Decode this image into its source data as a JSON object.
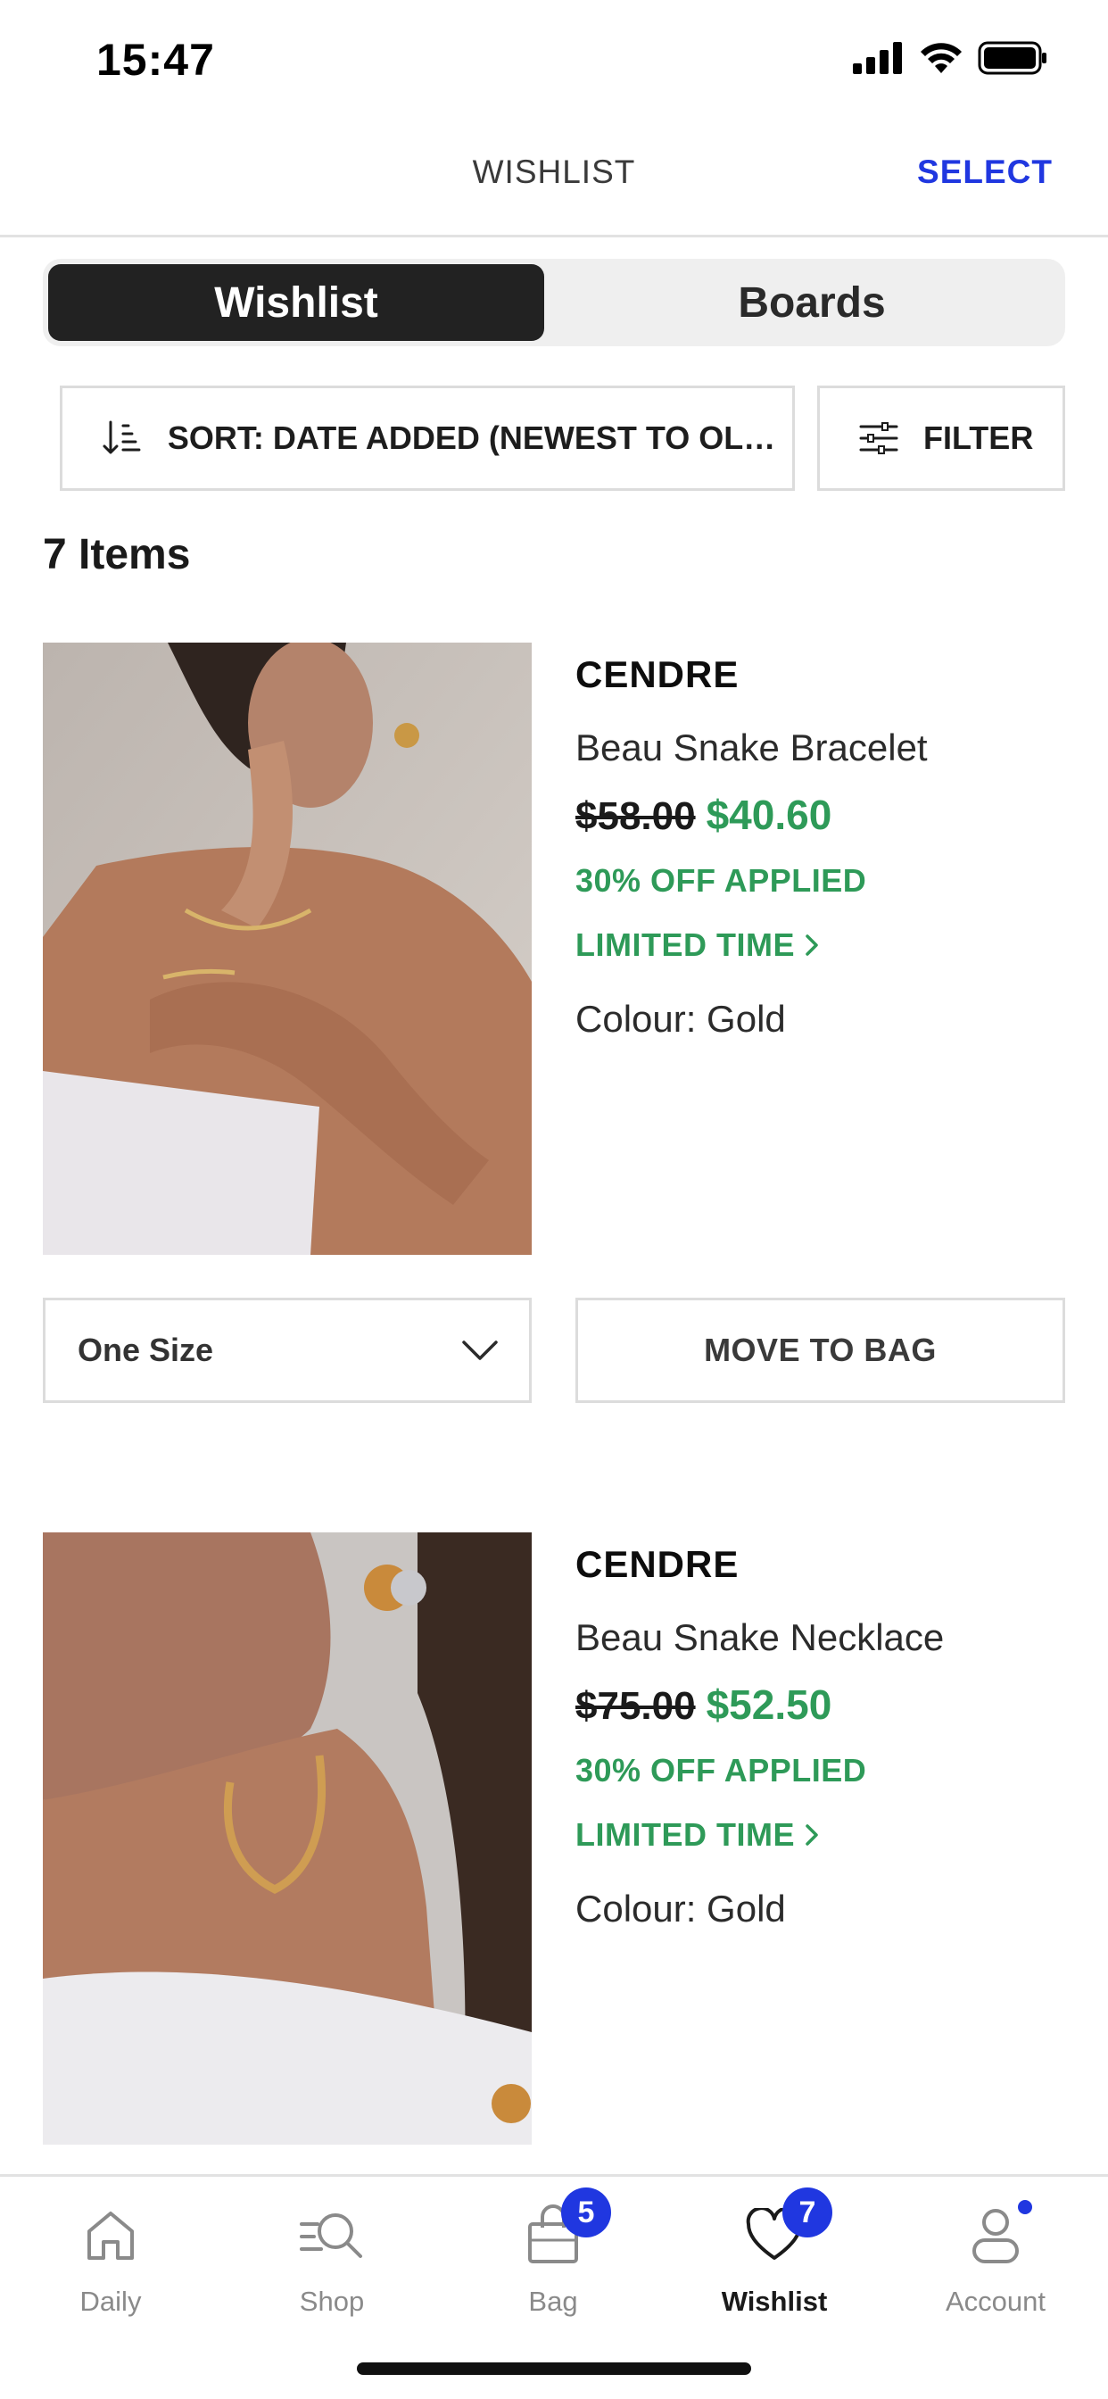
{
  "status": {
    "time": "15:47"
  },
  "header": {
    "title": "WISHLIST",
    "select_label": "SELECT"
  },
  "tabs": {
    "wishlist": "Wishlist",
    "boards": "Boards"
  },
  "toolbar": {
    "sort_label": "SORT: DATE ADDED (NEWEST TO OLD...",
    "filter_label": "FILTER"
  },
  "count_label": "7 Items",
  "products": [
    {
      "brand": "CENDRE",
      "name": "Beau Snake Bracelet",
      "old_price": "$58.00",
      "new_price": "$40.60",
      "discount": "30% OFF APPLIED",
      "limited": "LIMITED TIME",
      "colour": "Colour: Gold",
      "size": "One Size",
      "move_label": "MOVE TO BAG"
    },
    {
      "brand": "CENDRE",
      "name": "Beau Snake Necklace",
      "old_price": "$75.00",
      "new_price": "$52.50",
      "discount": "30% OFF APPLIED",
      "limited": "LIMITED TIME",
      "colour": "Colour: Gold"
    }
  ],
  "nav": {
    "items": [
      {
        "label": "Daily",
        "icon": "home-icon"
      },
      {
        "label": "Shop",
        "icon": "search-icon"
      },
      {
        "label": "Bag",
        "icon": "bag-icon",
        "badge": "5"
      },
      {
        "label": "Wishlist",
        "icon": "heart-icon",
        "badge": "7"
      },
      {
        "label": "Account",
        "icon": "account-icon"
      }
    ]
  },
  "colors": {
    "accent": "#2037e0",
    "sale": "#2e9a58",
    "segment_active": "#222222"
  }
}
